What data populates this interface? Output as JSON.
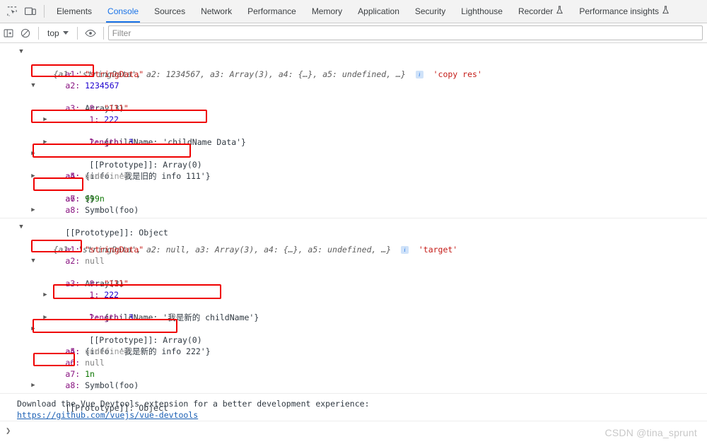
{
  "tabbar": {
    "icons": [
      {
        "name": "inspect-element-icon"
      },
      {
        "name": "device-toolbar-icon"
      }
    ],
    "tabs": [
      {
        "label": "Elements",
        "active": false,
        "flask": false
      },
      {
        "label": "Console",
        "active": true,
        "flask": false
      },
      {
        "label": "Sources",
        "active": false,
        "flask": false
      },
      {
        "label": "Network",
        "active": false,
        "flask": false
      },
      {
        "label": "Performance",
        "active": false,
        "flask": false
      },
      {
        "label": "Memory",
        "active": false,
        "flask": false
      },
      {
        "label": "Application",
        "active": false,
        "flask": false
      },
      {
        "label": "Security",
        "active": false,
        "flask": false
      },
      {
        "label": "Lighthouse",
        "active": false,
        "flask": false
      },
      {
        "label": "Recorder",
        "active": false,
        "flask": true
      },
      {
        "label": "Performance insights",
        "active": false,
        "flask": true
      }
    ]
  },
  "filterbar": {
    "sidebar_icon": "console-sidebar-icon",
    "clear_icon": "clear-console-icon",
    "context_value": "top",
    "eye_icon": "live-expression-icon",
    "filter_placeholder": "Filter",
    "filter_value": ""
  },
  "console": {
    "groups": [
      {
        "label": "'copy res'",
        "header": "{a1: 'stringData', a2: 1234567, a3: Array(3), a4: {…}, a5: undefined, …}",
        "header_parts": {
          "brace_open": "{",
          "p1": "a1: ",
          "v1": "'stringData'",
          "c1": ", ",
          "p2": "a2: ",
          "v2": "1234567",
          "c2": ", ",
          "p3": "a3: ",
          "v3": "Array(3)",
          "c3": ", ",
          "p4": "a4: ",
          "v4": "{…}",
          "c4": ", ",
          "p5": "a5: ",
          "v5": "undefined",
          "c5": ", ",
          "ellipsis": "…}"
        },
        "rows": [
          {
            "key": "a1:",
            "value": "\"stringData\"",
            "kind": "string"
          },
          {
            "key": "a2:",
            "value": "1234567",
            "kind": "number"
          },
          {
            "key": "a3:",
            "value": "Array(3)",
            "kind": "object"
          },
          {
            "key": "0:",
            "value": "\"111\"",
            "kind": "string"
          },
          {
            "key": "1:",
            "value": "222",
            "kind": "number"
          },
          {
            "key": "2:",
            "value": "{childName: 'childName Data'}",
            "kind": "object"
          },
          {
            "key": "length:",
            "value": "3",
            "kind": "number"
          },
          {
            "key": "[[Prototype]]:",
            "value": "Array(0)",
            "kind": "proto"
          },
          {
            "key": "a4:",
            "value": "{info: '我是旧的 info 111'}",
            "kind": "object"
          },
          {
            "key": "a5:",
            "value": "undefined",
            "kind": "undefined"
          },
          {
            "key": "a6:",
            "value": "{}",
            "kind": "object"
          },
          {
            "key": "a7:",
            "value": "999n",
            "kind": "bigint"
          },
          {
            "key": "a8:",
            "value": "Symbol(foo)",
            "kind": "symbol"
          },
          {
            "key": "[[Prototype]]:",
            "value": "Object",
            "kind": "proto"
          }
        ]
      },
      {
        "label": "'target'",
        "header": "{a1: 'stringData', a2: null, a3: Array(3), a4: {…}, a5: undefined, …}",
        "header_parts": {
          "brace_open": "{",
          "p1": "a1: ",
          "v1": "'stringData'",
          "c1": ", ",
          "p2": "a2: ",
          "v2": "null",
          "c2": ", ",
          "p3": "a3: ",
          "v3": "Array(3)",
          "c3": ", ",
          "p4": "a4: ",
          "v4": "{…}",
          "c4": ", ",
          "p5": "a5: ",
          "v5": "undefined",
          "c5": ", ",
          "ellipsis": "…}"
        },
        "rows": [
          {
            "key": "a1:",
            "value": "\"stringData\"",
            "kind": "string"
          },
          {
            "key": "a2:",
            "value": "null",
            "kind": "null"
          },
          {
            "key": "a3:",
            "value": "Array(3)",
            "kind": "object"
          },
          {
            "key": "0:",
            "value": "\"111\"",
            "kind": "string"
          },
          {
            "key": "1:",
            "value": "222",
            "kind": "number"
          },
          {
            "key": "2:",
            "value": "{childName: '我是新的 childName'}",
            "kind": "object"
          },
          {
            "key": "length:",
            "value": "3",
            "kind": "number"
          },
          {
            "key": "[[Prototype]]:",
            "value": "Array(0)",
            "kind": "proto"
          },
          {
            "key": "a4:",
            "value": "{info: '我是新的 info 222'}",
            "kind": "object"
          },
          {
            "key": "a5:",
            "value": "undefined",
            "kind": "undefined"
          },
          {
            "key": "a6:",
            "value": "null",
            "kind": "null"
          },
          {
            "key": "a7:",
            "value": "1n",
            "kind": "bigint"
          },
          {
            "key": "a8:",
            "value": "Symbol(foo)",
            "kind": "symbol"
          },
          {
            "key": "[[Prototype]]:",
            "value": "Object",
            "kind": "proto"
          }
        ]
      }
    ],
    "info_icon_char": "i"
  },
  "footer": {
    "vue_message": "Download the Vue Devtools extension for a better development experience:",
    "vue_link": "https://github.com/vuejs/vue-devtools",
    "prompt_symbol": "❯"
  },
  "watermark": "CSDN @tina_sprunt",
  "colors": {
    "accent": "#1a73e8",
    "annotation": "#ef0000",
    "string": "#c41a16",
    "number": "#1c00cf",
    "bigint": "#0b7500",
    "undefined": "#9a9a9a",
    "key": "#881280"
  }
}
